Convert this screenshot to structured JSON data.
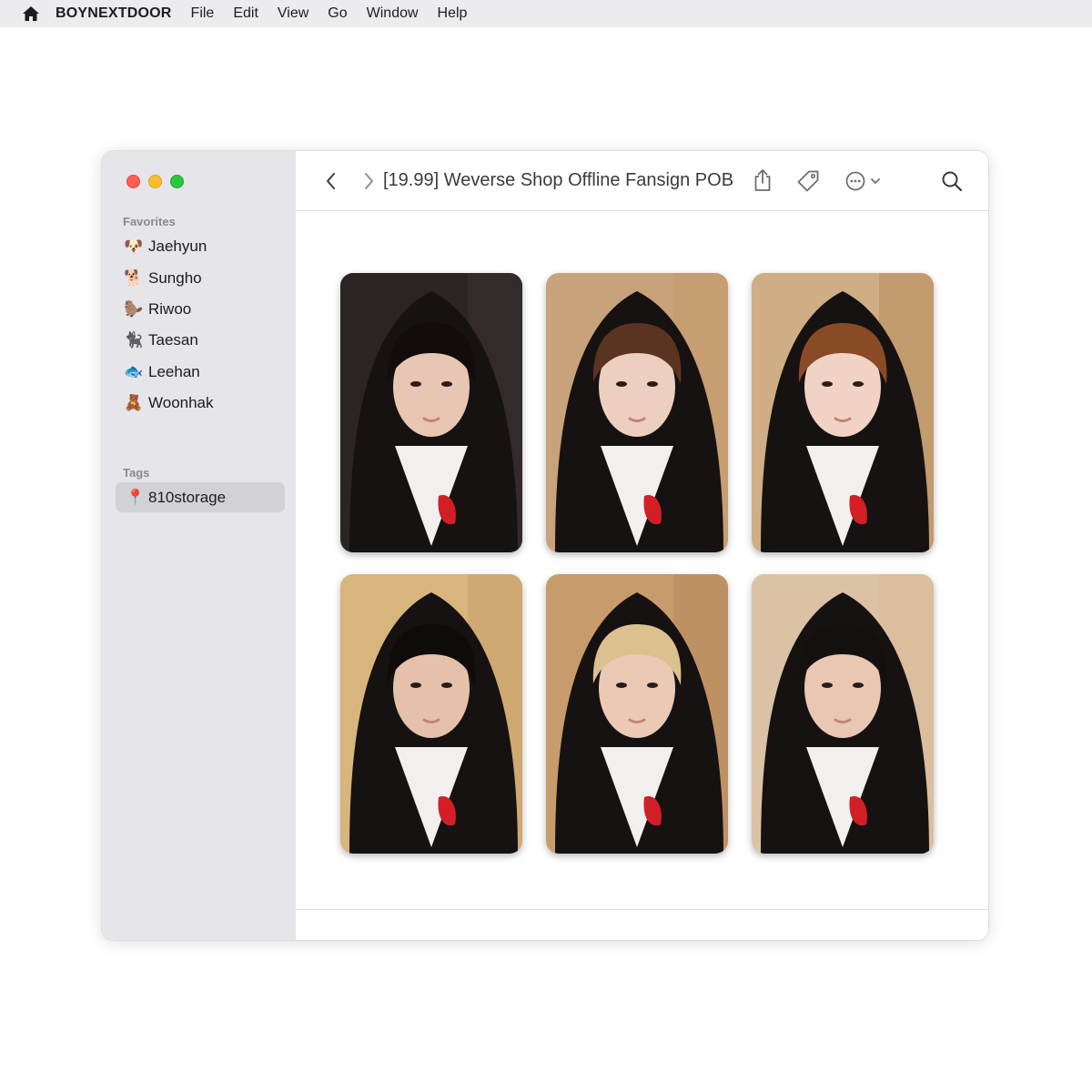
{
  "menubar": {
    "app_name": "BOYNEXTDOOR",
    "items": [
      "File",
      "Edit",
      "View",
      "Go",
      "Window",
      "Help"
    ],
    "home_icon": "house-icon"
  },
  "sidebar": {
    "favorites_title": "Favorites",
    "favorites": [
      {
        "emoji": "🐶",
        "label": "Jaehyun"
      },
      {
        "emoji": "🐕",
        "label": "Sungho"
      },
      {
        "emoji": "🦫",
        "label": "Riwoo"
      },
      {
        "emoji": "🐈‍⬛",
        "label": "Taesan"
      },
      {
        "emoji": "🐟",
        "label": "Leehan"
      },
      {
        "emoji": "🧸",
        "label": "Woonhak"
      }
    ],
    "tags_title": "Tags",
    "tags": [
      {
        "emoji": "📍",
        "label": "810storage"
      }
    ]
  },
  "toolbar": {
    "folder_title": "[19.99] Weverse Shop Offline Fansign POB"
  },
  "photos": [
    {
      "bg": "#2a2424",
      "hair": "#120d0c",
      "skin": "#e9c6b3",
      "wall": "#3a3030"
    },
    {
      "bg": "#c8a27a",
      "hair": "#5b3421",
      "skin": "#edcfbf",
      "wall": "#c69a6c"
    },
    {
      "bg": "#cfae85",
      "hair": "#8a4a25",
      "skin": "#f0d3c4",
      "wall": "#b98d60"
    },
    {
      "bg": "#d9b57e",
      "hair": "#0f0b0b",
      "skin": "#e5c1ac",
      "wall": "#caa06a"
    },
    {
      "bg": "#c79b6b",
      "hair": "#dcc08d",
      "skin": "#ecc9b5",
      "wall": "#b88b5d"
    },
    {
      "bg": "#dcc2a4",
      "hair": "#151010",
      "skin": "#e9c7b2",
      "wall": "#d8bb9b"
    }
  ],
  "colors": {
    "sidebar_bg": "#e5e5ea",
    "selected_tag_bg": "#d1d1d6",
    "traffic_red": "#ff5f57",
    "traffic_yellow": "#febc2e",
    "traffic_green": "#28c840"
  }
}
